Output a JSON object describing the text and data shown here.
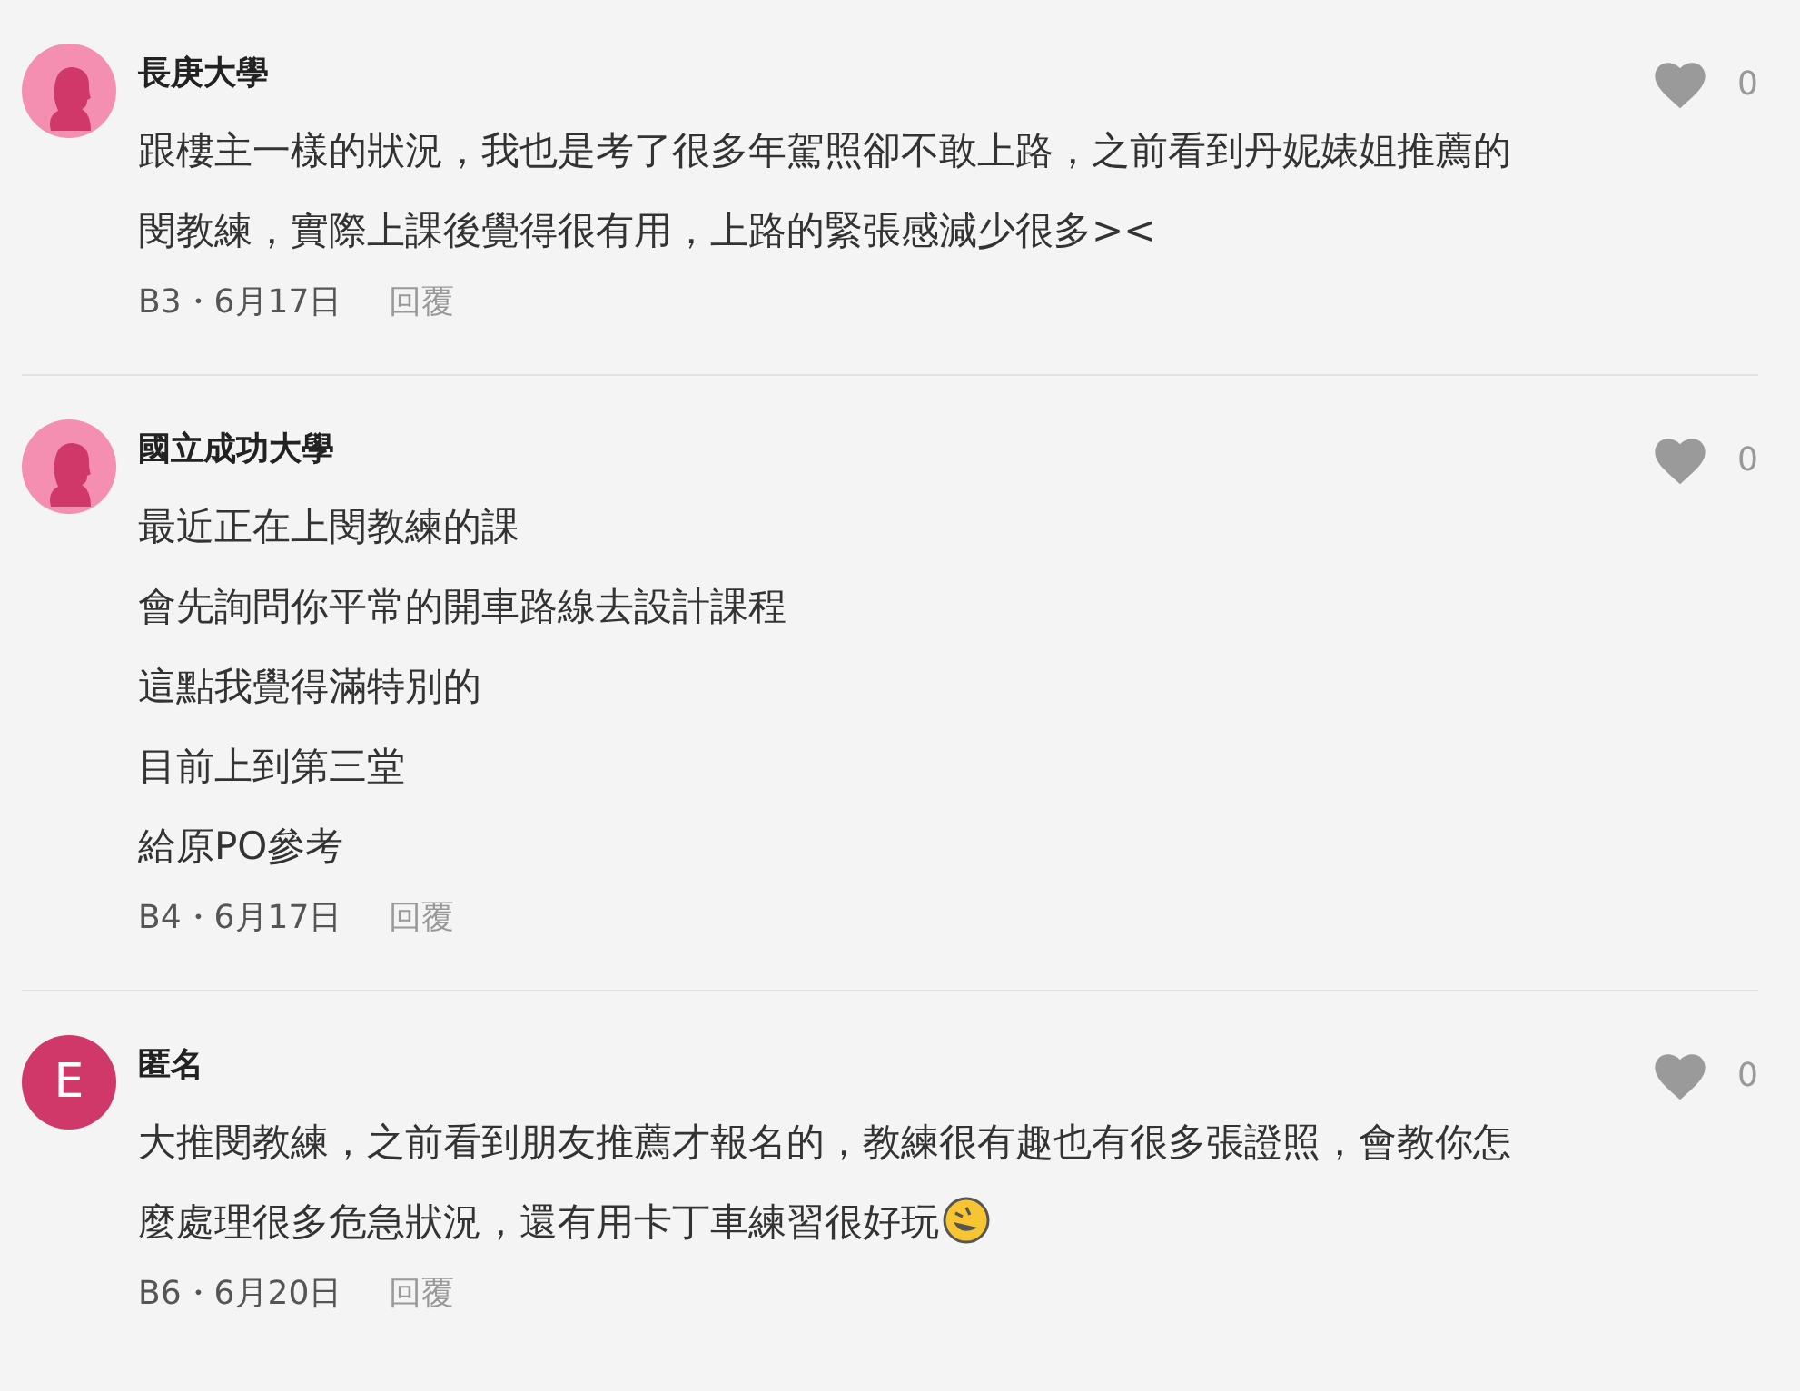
{
  "comments": [
    {
      "author": "長庚大學",
      "avatar": {
        "kind": "silhouette"
      },
      "likes": "0",
      "paragraphs": [
        "跟樓主一樣的狀況，我也是考了很多年駕照卻不敢上路，之前看到丹妮婊姐推薦的閔教練，實際上課後覺得很有用，上路的緊張感減少很多><"
      ],
      "emoji": false,
      "meta": "B3・6月17日",
      "reply": "回覆"
    },
    {
      "author": "國立成功大學",
      "avatar": {
        "kind": "silhouette"
      },
      "likes": "0",
      "paragraphs": [
        "最近正在上閔教練的課",
        "會先詢問你平常的開車路線去設計課程",
        "這點我覺得滿特別的",
        "目前上到第三堂",
        "給原PO參考"
      ],
      "emoji": false,
      "meta": "B4・6月17日",
      "reply": "回覆"
    },
    {
      "author": "匿名",
      "avatar": {
        "kind": "letter",
        "letter": "E"
      },
      "likes": "0",
      "paragraphs": [
        "大推閔教練，之前看到朋友推薦才報名的，教練很有趣也有很多張證照，會教你怎麼處理很多危急狀況，還有用卡丁車練習很好玩"
      ],
      "emoji": true,
      "meta": "B6・6月20日",
      "reply": "回覆"
    }
  ]
}
